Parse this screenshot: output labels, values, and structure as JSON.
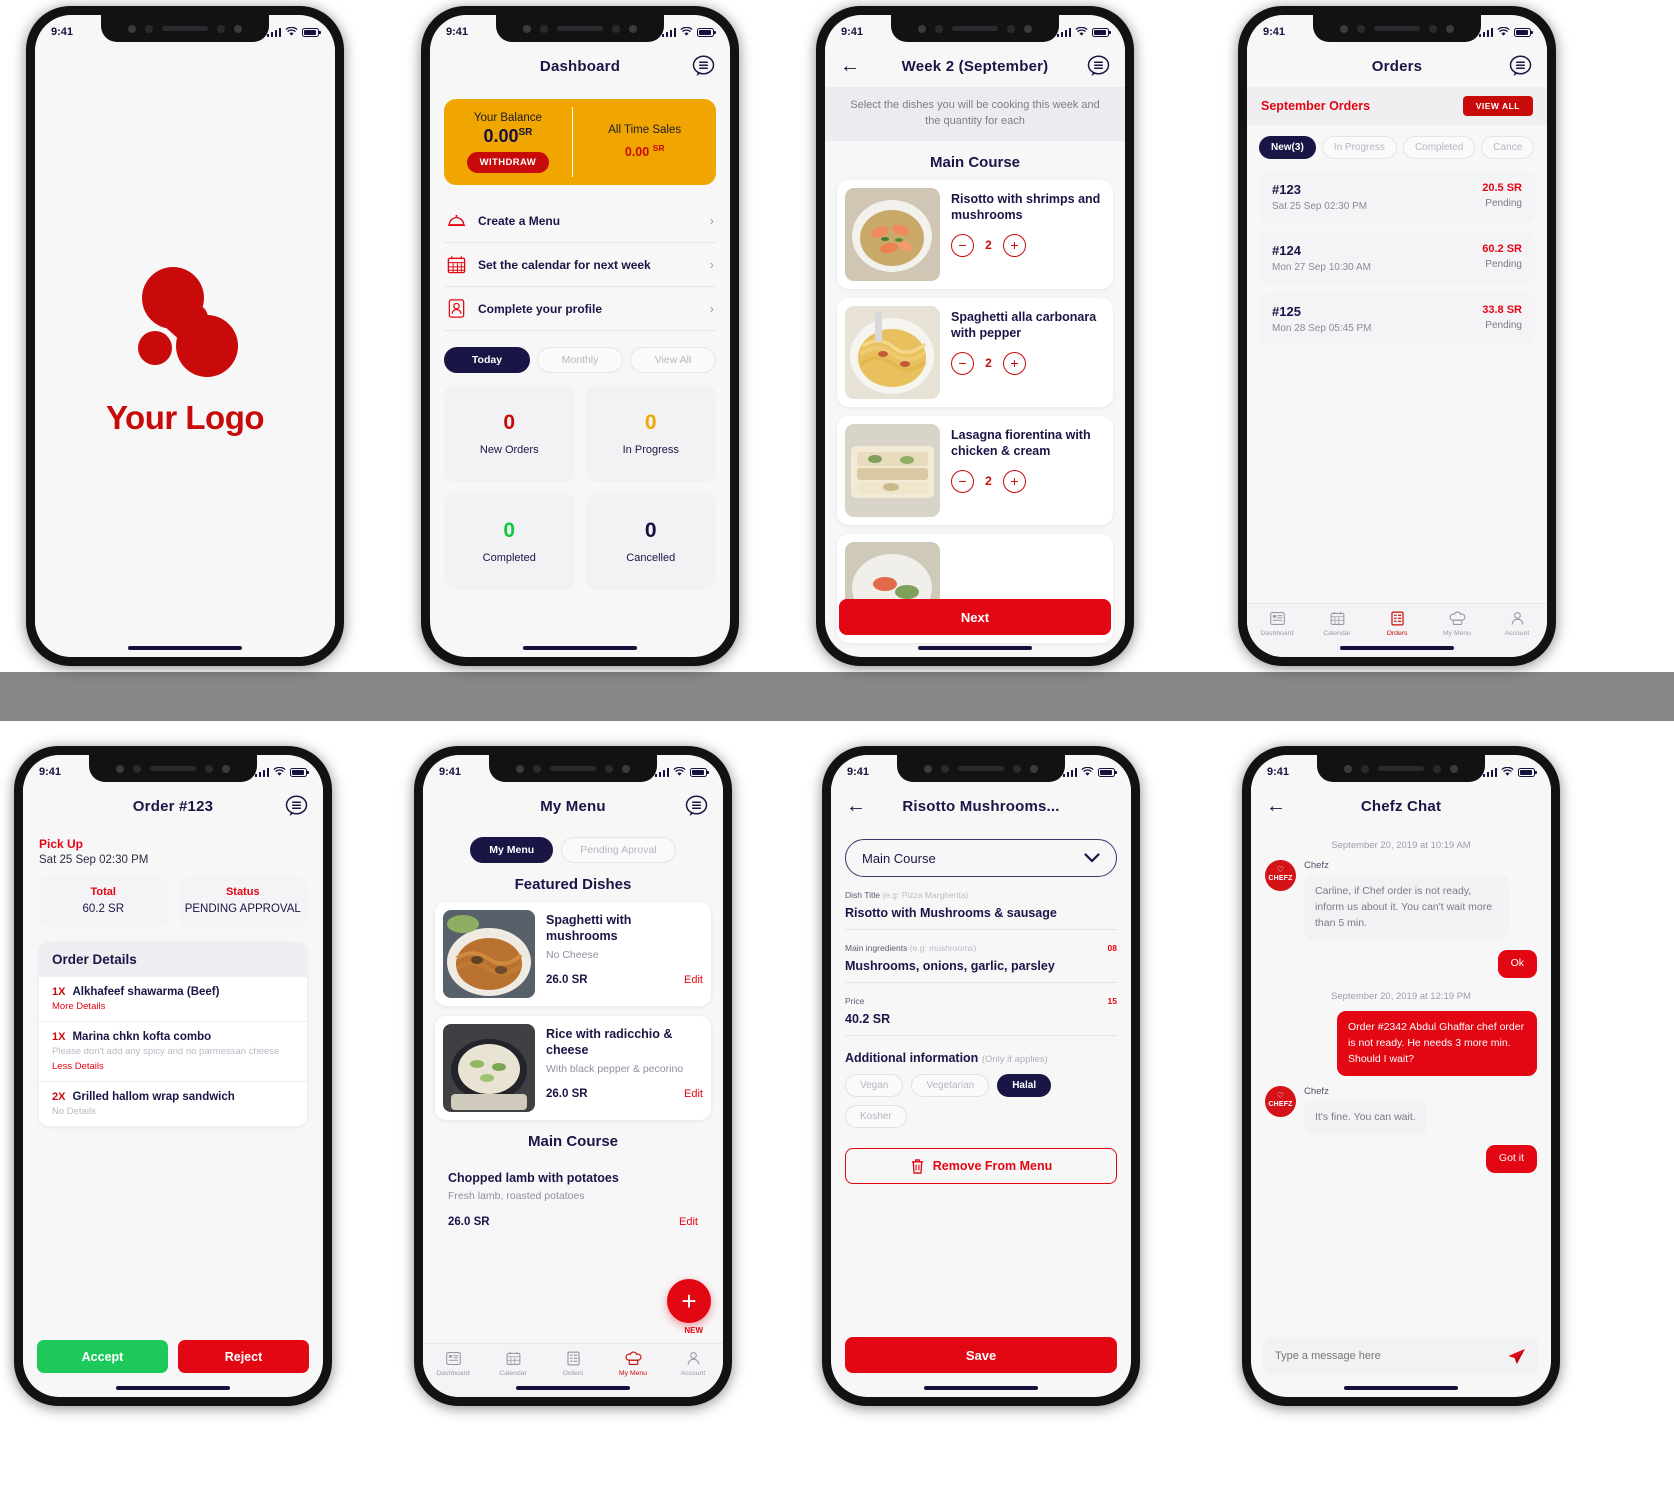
{
  "common": {
    "status_time": "9:41",
    "icons": {
      "wifi": "wifi-icon",
      "signal": "signal-icon",
      "battery": "battery-icon"
    }
  },
  "splash": {
    "logo_text": "Your Logo",
    "brand_color": "#c90a0a"
  },
  "dashboard": {
    "title": "Dashboard",
    "balance": {
      "label": "Your Balance",
      "amount": "0.00",
      "currency": "SR",
      "withdraw_label": "WITHDRAW",
      "sales_label": "All Time Sales",
      "sales_amount": "0.00",
      "sales_currency": "SR",
      "card_color": "#f0a500"
    },
    "actions": [
      {
        "label": "Create a Menu",
        "icon": "cloche-icon"
      },
      {
        "label": "Set the calendar for next week",
        "icon": "calendar-icon"
      },
      {
        "label": "Complete your profile",
        "icon": "user-icon"
      }
    ],
    "segments": [
      {
        "label": "Today",
        "active": true
      },
      {
        "label": "Monthly",
        "active": false
      },
      {
        "label": "View All",
        "active": false
      }
    ],
    "stats": [
      {
        "value": "0",
        "label": "New Orders",
        "color": "#c90a0a"
      },
      {
        "value": "0",
        "label": "In Progress",
        "color": "#f0a500"
      },
      {
        "value": "0",
        "label": "Completed",
        "color": "#10c93c"
      },
      {
        "value": "0",
        "label": "Cancelled",
        "color": "#14123d"
      }
    ]
  },
  "week": {
    "title": "Week 2 (September)",
    "banner": "Select the dishes you will be cooking this week and the quantity for each",
    "section_title": "Main Course",
    "dishes": [
      {
        "name": "Risotto with shrimps and mushrooms",
        "qty": "2"
      },
      {
        "name": "Spaghetti alla carbonara with pepper",
        "qty": "2"
      },
      {
        "name": "Lasagna fiorentina with chicken & cream",
        "qty": "2"
      }
    ],
    "next_label": "Next"
  },
  "orders": {
    "title": "Orders",
    "header_label": "September Orders",
    "view_all_label": "VIEW ALL",
    "filters": [
      {
        "label": "New(3)",
        "active": true
      },
      {
        "label": "In Progress",
        "active": false
      },
      {
        "label": "Completed",
        "active": false
      },
      {
        "label": "Cance",
        "active": false
      }
    ],
    "list": [
      {
        "id": "#123",
        "date": "Sat 25 Sep 02:30 PM",
        "amount": "20.5 SR",
        "status": "Pending"
      },
      {
        "id": "#124",
        "date": "Mon 27 Sep 10:30 AM",
        "amount": "60.2 SR",
        "status": "Pending"
      },
      {
        "id": "#125",
        "date": "Mon 28 Sep 05:45 PM",
        "amount": "33.8 SR",
        "status": "Pending"
      }
    ],
    "tabs": [
      {
        "label": "Dashboard",
        "icon": "dashboard-icon",
        "active": false
      },
      {
        "label": "Calendar",
        "icon": "calendar-icon",
        "active": false
      },
      {
        "label": "Orders",
        "icon": "orders-icon",
        "active": true
      },
      {
        "label": "My Menu",
        "icon": "chef-hat-icon",
        "active": false
      },
      {
        "label": "Account",
        "icon": "account-icon",
        "active": false
      }
    ]
  },
  "order_detail": {
    "title": "Order #123",
    "pickup_label": "Pick Up",
    "pickup_date": "Sat 25 Sep 02:30 PM",
    "total_label": "Total",
    "total_value": "60.2 SR",
    "status_label": "Status",
    "status_value": "PENDING APPROVAL",
    "details_header": "Order Details",
    "items": [
      {
        "qty": "1X",
        "name": "Alkhafeef shawarma (Beef)",
        "note": "",
        "link": "More Details"
      },
      {
        "qty": "1X",
        "name": "Marina chkn kofta combo",
        "note": "Please don't add any spicy and no parmessan cheese",
        "link": "Less Details"
      },
      {
        "qty": "2X",
        "name": "Grilled hallom wrap sandwich",
        "note": "No Details",
        "link": ""
      }
    ],
    "accept_label": "Accept",
    "reject_label": "Reject"
  },
  "my_menu": {
    "title": "My Menu",
    "segments": [
      {
        "label": "My Menu",
        "active": true
      },
      {
        "label": "Pending Aproval",
        "active": false
      }
    ],
    "featured_title": "Featured Dishes",
    "featured": [
      {
        "name": "Spaghetti with mushrooms",
        "desc": "No Cheese",
        "price": "26.0 SR",
        "edit": "Edit"
      },
      {
        "name": "Rice with radicchio & cheese",
        "desc": "With black pepper & pecorino",
        "price": "26.0 SR",
        "edit": "Edit"
      }
    ],
    "main_title": "Main Course",
    "main": [
      {
        "name": "Chopped lamb with potatoes",
        "desc": "Fresh lamb, roasted potatoes",
        "price": "26.0 SR",
        "edit": "Edit"
      }
    ],
    "fab_label": "NEW",
    "tabs": [
      {
        "label": "Dashboard",
        "icon": "dashboard-icon",
        "active": false
      },
      {
        "label": "Calendar",
        "icon": "calendar-icon",
        "active": false
      },
      {
        "label": "Orders",
        "icon": "orders-icon",
        "active": false
      },
      {
        "label": "My Menu",
        "icon": "chef-hat-icon",
        "active": true
      },
      {
        "label": "Account",
        "icon": "account-icon",
        "active": false
      }
    ]
  },
  "dish_edit": {
    "title": "Risotto Mushrooms...",
    "category_value": "Main Course",
    "dish_title_label": "Dish Title",
    "dish_title_hint": "(e.g: Pizza Margherita)",
    "dish_title_value": "Risotto with Mushrooms & sausage",
    "ingredients_label": "Main ingredients",
    "ingredients_hint": "(e.g: mushrooms)",
    "ingredients_value": "Mushrooms, onions, garlic, parsley",
    "ingredients_count": "08",
    "price_label": "Price",
    "price_value": "40.2 SR",
    "price_count": "15",
    "additional_label": "Additional information",
    "additional_hint": "(Only if applies)",
    "tags": [
      {
        "label": "Vegan",
        "on": false
      },
      {
        "label": "Vegetarian",
        "on": false
      },
      {
        "label": "Halal",
        "on": true
      },
      {
        "label": "Kosher",
        "on": false
      }
    ],
    "remove_label": "Remove From Menu",
    "save_label": "Save"
  },
  "chat": {
    "title": "Chefz Chat",
    "avatar_text": "CHEFZ",
    "timestamps": [
      "September 20, 2019 at 10:19 AM",
      "September 20, 2019 at 12:19 PM"
    ],
    "messages": [
      {
        "side": "in",
        "who": "Chefz",
        "text": "Carline, if Chef order is not ready, inform us about it. You can't wait more than 5 min."
      },
      {
        "side": "out",
        "who": "",
        "text": "Ok",
        "short": true
      },
      {
        "side": "out",
        "who": "",
        "text": "Order #2342 Abdul Ghaffar chef order is not ready. He needs 3 more min. Should I wait?",
        "short": false
      },
      {
        "side": "in",
        "who": "Chefz",
        "text": "It's fine. You can wait."
      },
      {
        "side": "out",
        "who": "",
        "text": "Got it",
        "short": true
      }
    ],
    "composer_placeholder": "Type a message here",
    "send_icon": "send-icon"
  }
}
